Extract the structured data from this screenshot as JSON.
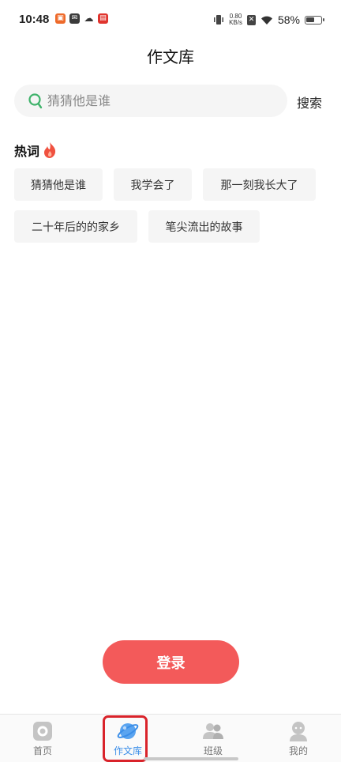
{
  "status_bar": {
    "time": "10:48",
    "net_speed_value": "0.80",
    "net_speed_unit": "KB/s",
    "battery_percent": "58%",
    "battery_level": 0.58
  },
  "page": {
    "title": "作文库"
  },
  "search": {
    "placeholder": "猜猜他是谁",
    "button_label": "搜索"
  },
  "hot_words": {
    "heading": "热词",
    "items": [
      "猜猜他是谁",
      "我学会了",
      "那一刻我长大了",
      "二十年后的的家乡",
      "笔尖流出的故事"
    ]
  },
  "login": {
    "label": "登录"
  },
  "tabbar": {
    "tabs": [
      {
        "label": "首页",
        "icon": "home-icon"
      },
      {
        "label": "作文库",
        "icon": "planet-icon"
      },
      {
        "label": "班级",
        "icon": "people-icon"
      },
      {
        "label": "我的",
        "icon": "user-icon"
      }
    ],
    "active_index": 1
  },
  "colors": {
    "accent_red": "#f35a5a",
    "active_blue": "#3b8ee8",
    "search_green": "#3fb36b",
    "highlight_red": "#d9232a"
  }
}
